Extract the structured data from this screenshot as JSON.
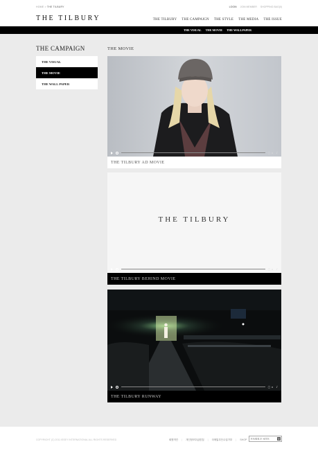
{
  "header": {
    "breadcrumb": {
      "home": "HOME",
      "sep": " > ",
      "current": "THE TILBURY"
    },
    "util_links": [
      "LOGIN",
      "JOIN MEMBER",
      "SHOPPING BAG(0)"
    ],
    "logo": "THE TILBURY",
    "gnb": [
      "THE TILBURY",
      "THE CAMPAIGN",
      "THE STYLE",
      "THE MEDIA",
      "THE ISSUE"
    ],
    "subnav": [
      "THE VISUAL",
      "THE MOVIE",
      "THE WALLPAPER"
    ]
  },
  "sidebar": {
    "title": "THE CAMPAIGN",
    "items": [
      {
        "label": "THE VISUAL",
        "active": false
      },
      {
        "label": "THE MOVIE",
        "active": true
      },
      {
        "label": "THE WALL PAPER",
        "active": false
      }
    ]
  },
  "main": {
    "title": "THE MOVIE",
    "videos": [
      {
        "caption": "THE TILBURY AD MOVIE",
        "theme": "light",
        "progress": 0.0
      },
      {
        "caption": "THE TILBURY BEHIND MOVIE",
        "theme": "dark",
        "progress": 0.01,
        "player_text": "THE TILBURY"
      },
      {
        "caption": "THE TILBURY RUNWAY",
        "theme": "dark",
        "progress": 0.0
      }
    ]
  },
  "footer": {
    "copyright": "COPYRIGHT (C) 2011 ISSEY INTERNATIONAL ALL RIGHTS RESERVED",
    "links": [
      "회원약관",
      "개인정보취급방침",
      "이메일무단수집거부",
      "SHOP"
    ],
    "family_site": "FAMILY SITE"
  },
  "colors": {
    "accent": "#000000",
    "background": "#ebebeb",
    "panel": "#ffffff"
  }
}
